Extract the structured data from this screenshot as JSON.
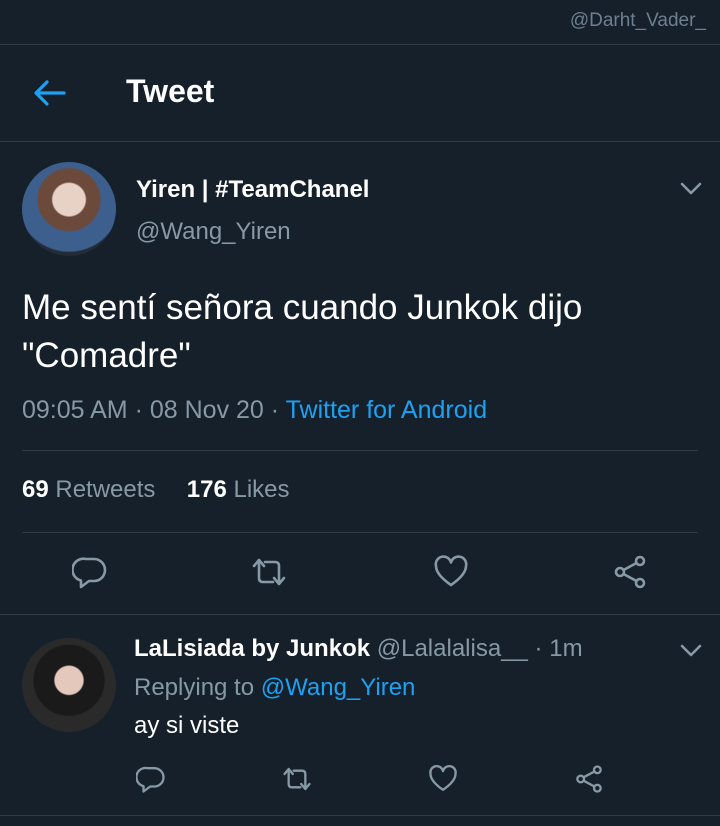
{
  "watermark": "@Darht_Vader_",
  "header": {
    "title": "Tweet"
  },
  "tweet": {
    "author_name": "Yiren | #TeamChanel",
    "author_handle": "@Wang_Yiren",
    "text_line1": "Me sentí señora cuando Junkok dijo",
    "text_line2": "\"Comadre\"",
    "time": "09:05 AM",
    "date": "08 Nov 20",
    "source": "Twitter for Android",
    "retweets_count": "69",
    "retweets_label": "Retweets",
    "likes_count": "176",
    "likes_label": "Likes"
  },
  "reply": {
    "author_name": "LaLisiada by Junkok",
    "author_handle": "@Lalalalisa__",
    "time": "1m",
    "replying_to_label": "Replying to",
    "replying_to_handle": "@Wang_Yiren",
    "text": "ay si viste"
  },
  "colors": {
    "background": "#15202b",
    "accent": "#1da1f2",
    "muted": "#8899a6",
    "divider": "#2f3b47"
  },
  "icons": [
    "arrow-left-icon",
    "chevron-down-icon",
    "reply-icon",
    "retweet-icon",
    "heart-icon",
    "share-icon"
  ]
}
